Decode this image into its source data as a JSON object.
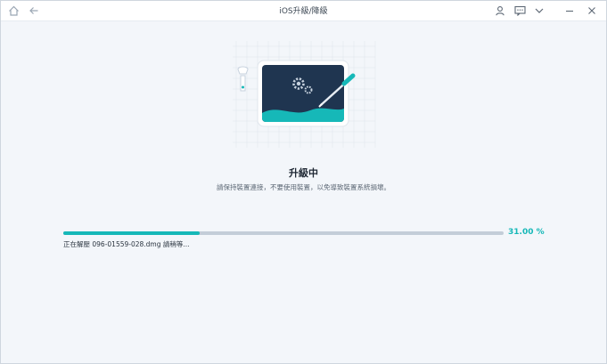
{
  "window": {
    "title": "iOS升級/降級"
  },
  "toolbar": {
    "home_icon": "home-icon",
    "back_icon": "back-arrow-icon",
    "user_icon": "user-icon",
    "feedback_icon": "feedback-icon",
    "menu_icon": "chevron-down-icon",
    "minimize_icon": "minimize-icon",
    "close_icon": "close-icon"
  },
  "main": {
    "heading": "升級中",
    "subtext": "請保持裝置連接，不要使用裝置，以免導致裝置系統損壞。",
    "progress": {
      "value": 31.0,
      "label": "31.00 %"
    },
    "status": "正在解壓 096-01559-028.dmg 請稍等..."
  },
  "colors": {
    "accent": "#16b8b8",
    "screen": "#1f3550",
    "track": "#c3cdd8"
  }
}
